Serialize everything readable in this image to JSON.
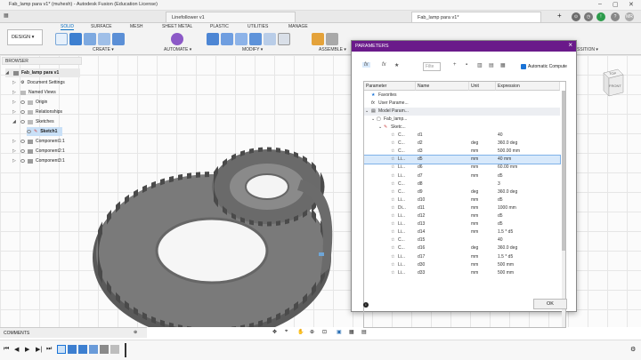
{
  "window": {
    "title": "Fab_lamp para v1* (muhesh) - Autodesk Fusion (Education License)"
  },
  "tabs": [
    {
      "label": "Linefollower v1"
    },
    {
      "label": "Fab_lamp para v1*"
    }
  ],
  "user": {
    "initials": "MR"
  },
  "workspace": {
    "label": "DESIGN ▾"
  },
  "ribbon": {
    "tabs": [
      "SOLID",
      "SURFACE",
      "MESH",
      "SHEET METAL",
      "PLASTIC",
      "UTILITIES",
      "MANAGE"
    ],
    "active_tab": "SOLID",
    "groups": [
      "CREATE ▾",
      "AUTOMATE ▾",
      "MODIFY ▾",
      "ASSEMBLE ▾"
    ],
    "right_group": "SSITION ▾"
  },
  "browser": {
    "title": "BROWSER",
    "items": [
      "Fab_lamp para v1",
      "Document Settings",
      "Named Views",
      "Origin",
      "Relationships",
      "Sketches",
      "Sketch1",
      "Component1:1",
      "Component2:1",
      "Component3:1"
    ]
  },
  "dialog": {
    "title": "PARAMETERS",
    "filter_placeholder": "Filte",
    "auto_compute_label": "Automatic Compute",
    "columns": [
      "Parameter",
      "Name",
      "Unit",
      "Expression"
    ],
    "tree": [
      "Favorites",
      "User Parame...",
      "Model Param...",
      "Fab_lamp...",
      "Sketc..."
    ],
    "rows": [
      {
        "p": "C...",
        "name": "d1",
        "unit": "",
        "expr": "40"
      },
      {
        "p": "C...",
        "name": "d2",
        "unit": "deg",
        "expr": "360.0 deg"
      },
      {
        "p": "C...",
        "name": "d3",
        "unit": "mm",
        "expr": "500.00 mm"
      },
      {
        "p": "Li...",
        "name": "d5",
        "unit": "mm",
        "expr": "40 mm"
      },
      {
        "p": "Li...",
        "name": "d6",
        "unit": "mm",
        "expr": "60.00 mm"
      },
      {
        "p": "Li...",
        "name": "d7",
        "unit": "mm",
        "expr": "d5"
      },
      {
        "p": "C...",
        "name": "d8",
        "unit": "",
        "expr": "3"
      },
      {
        "p": "C...",
        "name": "d9",
        "unit": "deg",
        "expr": "360.0 deg"
      },
      {
        "p": "Li...",
        "name": "d10",
        "unit": "mm",
        "expr": "d5"
      },
      {
        "p": "Di...",
        "name": "d11",
        "unit": "mm",
        "expr": "1000 mm"
      },
      {
        "p": "Li...",
        "name": "d12",
        "unit": "mm",
        "expr": "d5"
      },
      {
        "p": "Li...",
        "name": "d13",
        "unit": "mm",
        "expr": "d5"
      },
      {
        "p": "Li...",
        "name": "d14",
        "unit": "mm",
        "expr": "1.5 * d5"
      },
      {
        "p": "C...",
        "name": "d15",
        "unit": "",
        "expr": "40"
      },
      {
        "p": "C...",
        "name": "d16",
        "unit": "deg",
        "expr": "360.0 deg"
      },
      {
        "p": "Li...",
        "name": "d17",
        "unit": "mm",
        "expr": "1.5 * d5"
      },
      {
        "p": "Li...",
        "name": "d30",
        "unit": "mm",
        "expr": "500 mm"
      },
      {
        "p": "Li...",
        "name": "d33",
        "unit": "mm",
        "expr": "500 mm"
      }
    ],
    "ok_label": "OK"
  },
  "comments": {
    "label": "COMMENTS"
  },
  "viewcube": {
    "top": "TOP",
    "front": "FRONT"
  },
  "colors": {
    "accent": "#0a6fc2",
    "dialog_header": "#6a1a8a",
    "selected_row": "#d8e9fb"
  }
}
